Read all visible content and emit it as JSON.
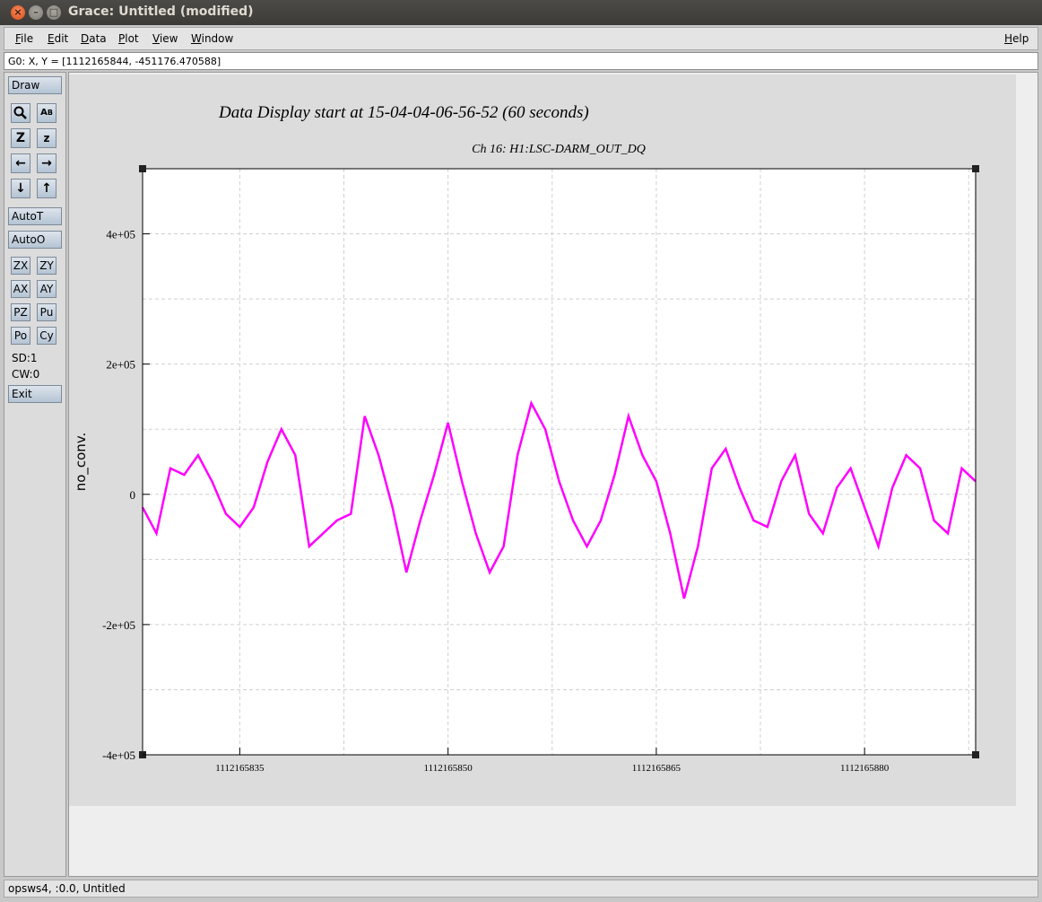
{
  "window": {
    "title": "Grace: Untitled (modified)"
  },
  "menu": {
    "file": "File",
    "edit": "Edit",
    "data": "Data",
    "plot": "Plot",
    "view": "View",
    "window": "Window",
    "help": "Help"
  },
  "locator": "G0: X, Y = [1112165844, -451176.470588]",
  "toolbar": {
    "draw": "Draw",
    "zoom_icon": "zoom-magnifier-icon",
    "text_icon": "text-tool-icon",
    "autot": "AutoT",
    "autoo": "AutoO",
    "zx": "ZX",
    "zy": "ZY",
    "ax": "AX",
    "ay": "AY",
    "pz": "PZ",
    "pu": "Pu",
    "po": "Po",
    "cy": "Cy",
    "sd": "SD:1",
    "cw": "CW:0",
    "exit": "Exit"
  },
  "status": "opsws4, :0.0, Untitled",
  "colors": {
    "series": "#ff00ff",
    "graph_bg": "#ffffff",
    "page_bg": "#dcdcdc",
    "button_face": "#c5d2de"
  },
  "chart_data": {
    "type": "line",
    "title": "Data Display start at 15-04-04-06-56-52 (60 seconds)",
    "subtitle": "Ch 16: H1:LSC-DARM_OUT_DQ",
    "xlabel": "",
    "ylabel": "no_conv.",
    "xlim": [
      1112165828,
      1112165888
    ],
    "ylim": [
      -400000,
      500000
    ],
    "x_ticks": [
      1112165835,
      1112165850,
      1112165865,
      1112165880
    ],
    "x_tick_labels": [
      "1112165835",
      "1112165850",
      "1112165865",
      "1112165880"
    ],
    "y_ticks": [
      -400000,
      -200000,
      0,
      200000,
      400000
    ],
    "y_tick_labels": [
      "-4e+05",
      "-2e+05",
      "0",
      "2e+05",
      "4e+05"
    ],
    "grid": true,
    "series": [
      {
        "color": "#ff00ff",
        "x": [
          1112165828,
          1112165829,
          1112165830,
          1112165831,
          1112165832,
          1112165833,
          1112165834,
          1112165835,
          1112165836,
          1112165837,
          1112165838,
          1112165839,
          1112165840,
          1112165841,
          1112165842,
          1112165843,
          1112165844,
          1112165845,
          1112165846,
          1112165847,
          1112165848,
          1112165849,
          1112165850,
          1112165851,
          1112165852,
          1112165853,
          1112165854,
          1112165855,
          1112165856,
          1112165857,
          1112165858,
          1112165859,
          1112165860,
          1112165861,
          1112165862,
          1112165863,
          1112165864,
          1112165865,
          1112165866,
          1112165867,
          1112165868,
          1112165869,
          1112165870,
          1112165871,
          1112165872,
          1112165873,
          1112165874,
          1112165875,
          1112165876,
          1112165877,
          1112165878,
          1112165879,
          1112165880,
          1112165881,
          1112165882,
          1112165883,
          1112165884,
          1112165885,
          1112165886,
          1112165887,
          1112165888
        ],
        "y": [
          -20000,
          -60000,
          40000,
          30000,
          60000,
          20000,
          -30000,
          -50000,
          -20000,
          50000,
          100000,
          60000,
          -80000,
          -60000,
          -40000,
          -30000,
          120000,
          60000,
          -20000,
          -120000,
          -40000,
          30000,
          110000,
          20000,
          -60000,
          -120000,
          -80000,
          60000,
          140000,
          100000,
          20000,
          -40000,
          -80000,
          -40000,
          30000,
          120000,
          60000,
          20000,
          -60000,
          -160000,
          -80000,
          40000,
          70000,
          10000,
          -40000,
          -50000,
          20000,
          60000,
          -30000,
          -60000,
          10000,
          40000,
          -20000,
          -80000,
          10000,
          60000,
          40000,
          -40000,
          -60000,
          40000,
          20000
        ]
      }
    ]
  }
}
